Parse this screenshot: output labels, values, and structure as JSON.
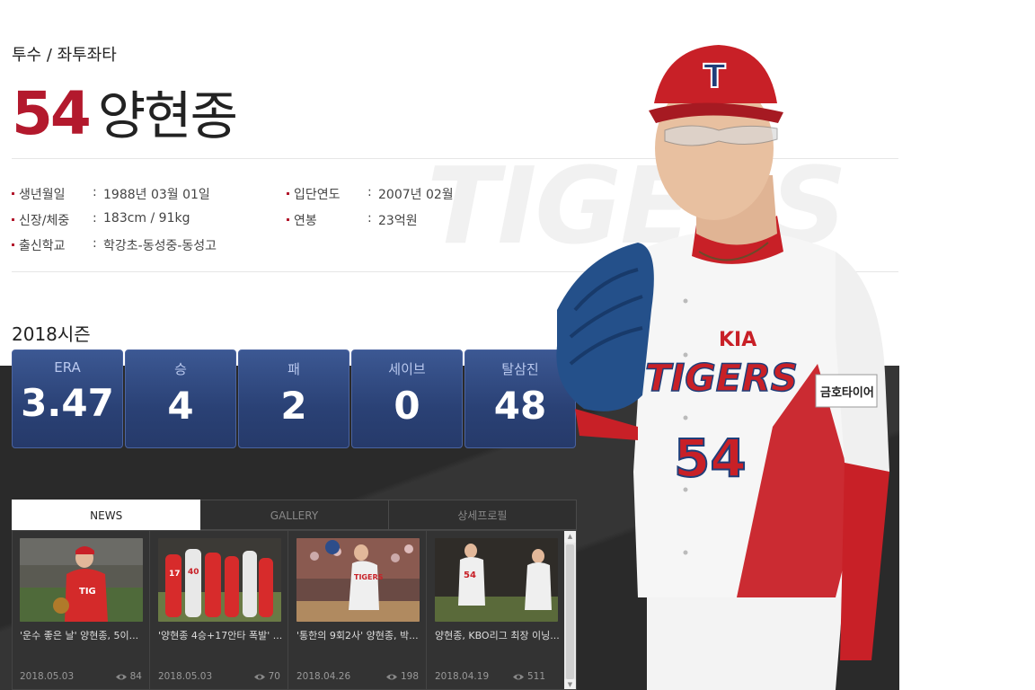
{
  "profile": {
    "position": "투수 / 좌투좌타",
    "number": "54",
    "name": "양현종",
    "watermark": "TIGERS"
  },
  "info": {
    "birth_label": "생년월일",
    "birth_value": "1988년 03월 01일",
    "join_label": "입단연도",
    "join_value": "2007년 02월",
    "body_label": "신장/체중",
    "body_value": "183cm / 91kg",
    "salary_label": "연봉",
    "salary_value": "23억원",
    "school_label": "출신학교",
    "school_value": "학강초-동성중-동성고",
    "colon": ":"
  },
  "season": {
    "title": "2018시즌",
    "stats": [
      {
        "label": "ERA",
        "value": "3.47"
      },
      {
        "label": "승",
        "value": "4"
      },
      {
        "label": "패",
        "value": "2"
      },
      {
        "label": "세이브",
        "value": "0"
      },
      {
        "label": "탈삼진",
        "value": "48"
      }
    ]
  },
  "tabs": [
    "NEWS",
    "GALLERY",
    "상세프로필"
  ],
  "news": [
    {
      "title": "'운수 좋은 날' 양현종, 5이...",
      "date": "2018.05.03",
      "views": "84"
    },
    {
      "title": "'양현종 4승+17안타 폭발' ...",
      "date": "2018.05.03",
      "views": "70"
    },
    {
      "title": "'통한의 9회2사' 양현종, 박...",
      "date": "2018.04.26",
      "views": "198"
    },
    {
      "title": "양현종, KBO리그 최장 이닝...",
      "date": "2018.04.19",
      "views": "511"
    }
  ],
  "photo": {
    "cap_logo": "T",
    "jersey_brand": "KIA",
    "jersey_team": "TIGERS",
    "jersey_number": "54",
    "sleeve_patch": "금호타이어"
  },
  "colors": {
    "accent": "#b3192d",
    "stat_card": "#2a4175",
    "dark_band": "#2a2a2a"
  },
  "icons": [
    "eye-icon",
    "scroll-up-icon",
    "scroll-down-icon"
  ]
}
